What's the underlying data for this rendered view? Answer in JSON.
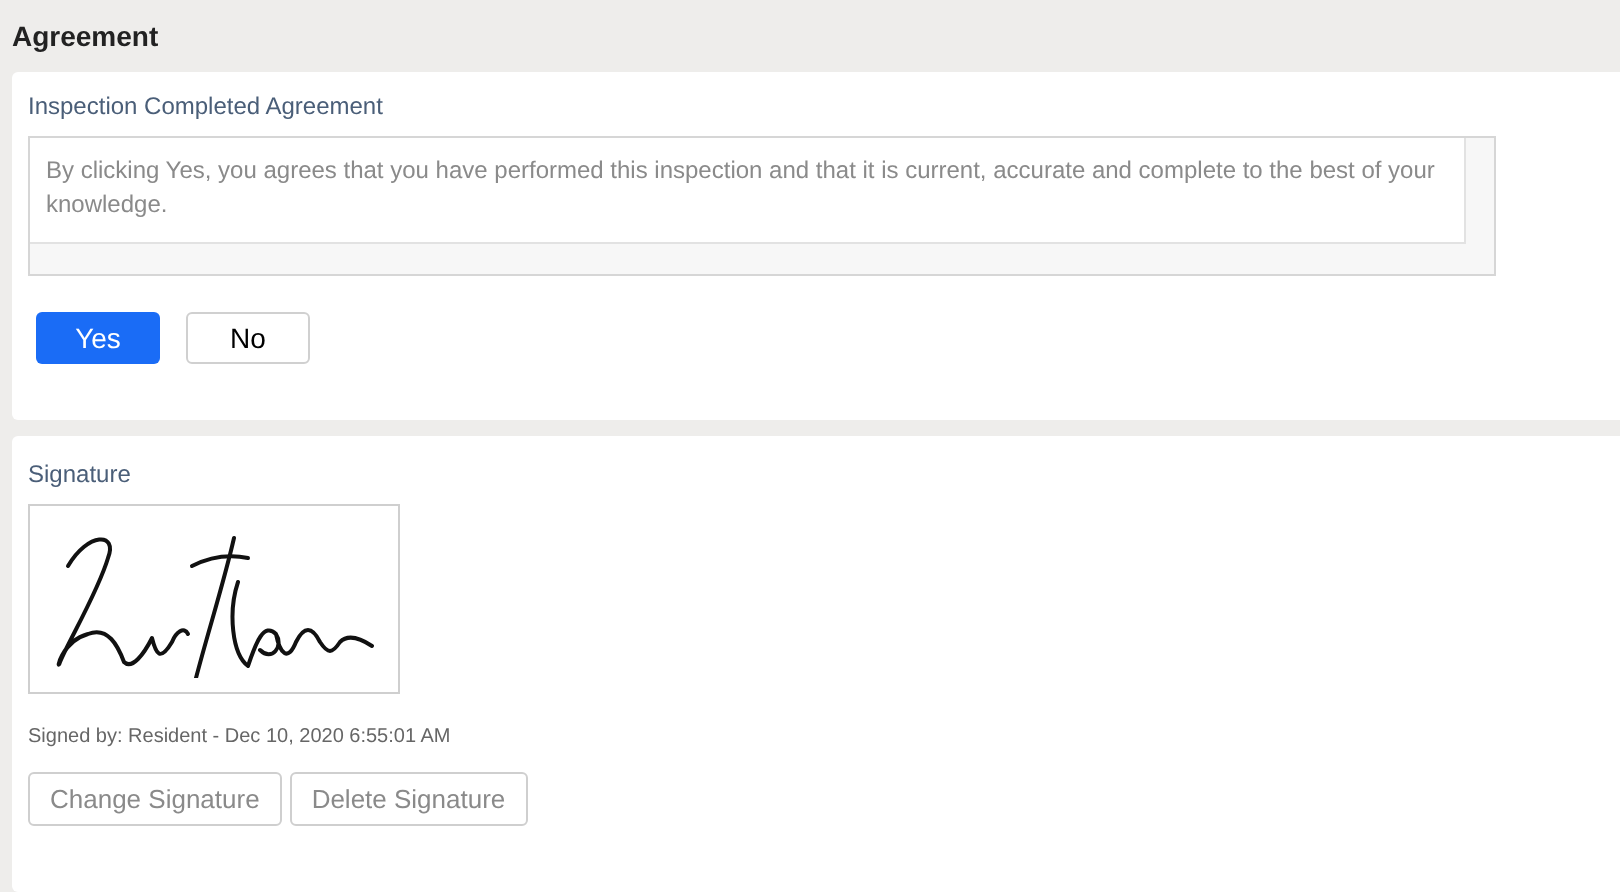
{
  "section_title": "Agreement",
  "agreement": {
    "label": "Inspection Completed Agreement",
    "text": "By clicking Yes, you agrees that you have performed this inspection and that it is current, accurate and complete to the best of your knowledge.",
    "options": [
      {
        "label": "Yes",
        "selected": true
      },
      {
        "label": "No",
        "selected": false
      }
    ]
  },
  "signature": {
    "label": "Signature",
    "signed_by": "Signed by: Resident - Dec 10, 2020 6:55:01 AM",
    "buttons": [
      {
        "label": "Change Signature",
        "disabled": true
      },
      {
        "label": "Delete Signature",
        "disabled": true
      }
    ]
  }
}
